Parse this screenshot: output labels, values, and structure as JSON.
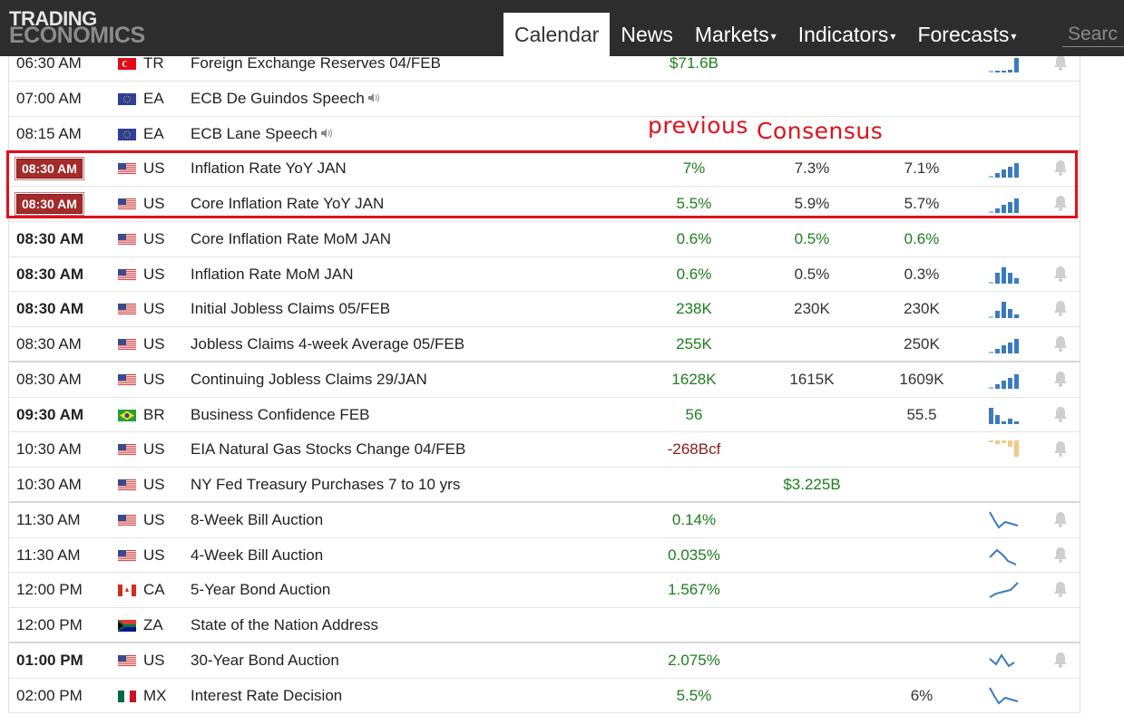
{
  "header": {
    "logo_line1": "TRADING",
    "logo_line2": "ECONOMICS",
    "nav": [
      {
        "label": "Calendar",
        "caret": "",
        "active": true
      },
      {
        "label": "News",
        "caret": "",
        "active": false
      },
      {
        "label": "Markets",
        "caret": "▾",
        "active": false
      },
      {
        "label": "Indicators",
        "caret": "▾",
        "active": false
      },
      {
        "label": "Forecasts",
        "caret": "▾",
        "active": false
      }
    ],
    "search_placeholder": "Search"
  },
  "annotations": {
    "previous": "previous",
    "consensus": "Consensus"
  },
  "colors": {
    "header_bg": "#2d2d2d",
    "highlight_border": "#e0101a",
    "positive": "#1e7e1e",
    "negative": "#8b1a1a",
    "time_badge": "#a52a2a",
    "sparkline": "#3a7bbf"
  },
  "rows": [
    {
      "time": "06:30 AM",
      "time_style": "normal",
      "flag": "TR",
      "country": "TR",
      "event": "Foreign Exchange Reserves 04/FEB",
      "speech": false,
      "actual": "$71.6B",
      "actual_color": "green",
      "consensus": "",
      "forecast": "",
      "chart": "bars-up-small",
      "bell": true
    },
    {
      "time": "07:00 AM",
      "time_style": "normal",
      "flag": "EU",
      "country": "EA",
      "event": "ECB De Guindos Speech",
      "speech": true,
      "actual": "",
      "actual_color": "",
      "consensus": "",
      "forecast": "",
      "chart": "",
      "bell": false
    },
    {
      "time": "08:15 AM",
      "time_style": "normal",
      "flag": "EU",
      "country": "EA",
      "event": "ECB Lane Speech",
      "speech": true,
      "actual": "",
      "actual_color": "",
      "consensus": "",
      "forecast": "",
      "chart": "",
      "bell": false,
      "group_end": true
    },
    {
      "time": "08:30 AM",
      "time_style": "badge",
      "flag": "US",
      "country": "US",
      "event": "Inflation Rate YoY JAN",
      "speech": false,
      "actual": "7%",
      "actual_color": "green",
      "consensus": "7.3%",
      "forecast": "7.1%",
      "chart": "bars-up",
      "bell": true
    },
    {
      "time": "08:30 AM",
      "time_style": "badge",
      "flag": "US",
      "country": "US",
      "event": "Core Inflation Rate YoY JAN",
      "speech": false,
      "actual": "5.5%",
      "actual_color": "green",
      "consensus": "5.9%",
      "forecast": "5.7%",
      "chart": "bars-up",
      "bell": true
    },
    {
      "time": "08:30 AM",
      "time_style": "bold",
      "flag": "US",
      "country": "US",
      "event": "Core Inflation Rate MoM JAN",
      "speech": false,
      "actual": "0.6%",
      "actual_color": "green",
      "consensus": "0.5%",
      "consensus_color": "green",
      "forecast": "0.6%",
      "forecast_color": "green",
      "chart": "",
      "bell": false
    },
    {
      "time": "08:30 AM",
      "time_style": "bold",
      "flag": "US",
      "country": "US",
      "event": "Inflation Rate MoM JAN",
      "speech": false,
      "actual": "0.6%",
      "actual_color": "green",
      "consensus": "0.5%",
      "forecast": "0.3%",
      "chart": "bars-mid",
      "bell": true
    },
    {
      "time": "08:30 AM",
      "time_style": "bold",
      "flag": "US",
      "country": "US",
      "event": "Initial Jobless Claims 05/FEB",
      "speech": false,
      "actual": "238K",
      "actual_color": "green",
      "consensus": "230K",
      "forecast": "230K",
      "chart": "bars-peak",
      "bell": true
    },
    {
      "time": "08:30 AM",
      "time_style": "normal",
      "flag": "US",
      "country": "US",
      "event": "Jobless Claims 4-week Average 05/FEB",
      "speech": false,
      "actual": "255K",
      "actual_color": "green",
      "consensus": "",
      "forecast": "250K",
      "chart": "bars-up",
      "bell": true,
      "group_end": true
    },
    {
      "time": "08:30 AM",
      "time_style": "normal",
      "flag": "US",
      "country": "US",
      "event": "Continuing Jobless Claims 29/JAN",
      "speech": false,
      "actual": "1628K",
      "actual_color": "green",
      "consensus": "1615K",
      "forecast": "1609K",
      "chart": "bars-up",
      "bell": true
    },
    {
      "time": "09:30 AM",
      "time_style": "bold",
      "flag": "BR",
      "country": "BR",
      "event": "Business Confidence FEB",
      "speech": false,
      "actual": "56",
      "actual_color": "green",
      "consensus": "",
      "forecast": "55.5",
      "chart": "bars-down",
      "bell": true
    },
    {
      "time": "10:30 AM",
      "time_style": "normal",
      "flag": "US",
      "country": "US",
      "event": "EIA Natural Gas Stocks Change 04/FEB",
      "speech": false,
      "actual": "-268Bcf",
      "actual_color": "red",
      "consensus": "",
      "forecast": "",
      "chart": "bars-neg",
      "bell": true
    },
    {
      "time": "10:30 AM",
      "time_style": "normal",
      "flag": "US",
      "country": "US",
      "event": "NY Fed Treasury Purchases 7 to 10 yrs",
      "speech": false,
      "actual": "",
      "actual_color": "",
      "consensus": "$3.225B",
      "consensus_color": "green",
      "forecast": "",
      "chart": "",
      "bell": false,
      "group_end": true
    },
    {
      "time": "11:30 AM",
      "time_style": "normal",
      "flag": "US",
      "country": "US",
      "event": "8-Week Bill Auction",
      "speech": false,
      "actual": "0.14%",
      "actual_color": "green",
      "consensus": "",
      "forecast": "",
      "chart": "line-down",
      "bell": true
    },
    {
      "time": "11:30 AM",
      "time_style": "normal",
      "flag": "US",
      "country": "US",
      "event": "4-Week Bill Auction",
      "speech": false,
      "actual": "0.035%",
      "actual_color": "green",
      "consensus": "",
      "forecast": "",
      "chart": "line-peak",
      "bell": true
    },
    {
      "time": "12:00 PM",
      "time_style": "normal",
      "flag": "CA",
      "country": "CA",
      "event": "5-Year Bond Auction",
      "speech": false,
      "actual": "1.567%",
      "actual_color": "green",
      "consensus": "",
      "forecast": "",
      "chart": "line-up",
      "bell": true
    },
    {
      "time": "12:00 PM",
      "time_style": "normal",
      "flag": "ZA",
      "country": "ZA",
      "event": "State of the Nation Address",
      "speech": false,
      "actual": "",
      "actual_color": "",
      "consensus": "",
      "forecast": "",
      "chart": "",
      "bell": false,
      "group_end": true
    },
    {
      "time": "01:00 PM",
      "time_style": "bold",
      "flag": "US",
      "country": "US",
      "event": "30-Year Bond Auction",
      "speech": false,
      "actual": "2.075%",
      "actual_color": "green",
      "consensus": "",
      "forecast": "",
      "chart": "line-zig",
      "bell": true
    },
    {
      "time": "02:00 PM",
      "time_style": "normal",
      "flag": "MX",
      "country": "MX",
      "event": "Interest Rate Decision",
      "speech": false,
      "actual": "5.5%",
      "actual_color": "green",
      "consensus": "",
      "forecast": "6%",
      "chart": "line-down",
      "bell": false
    }
  ]
}
